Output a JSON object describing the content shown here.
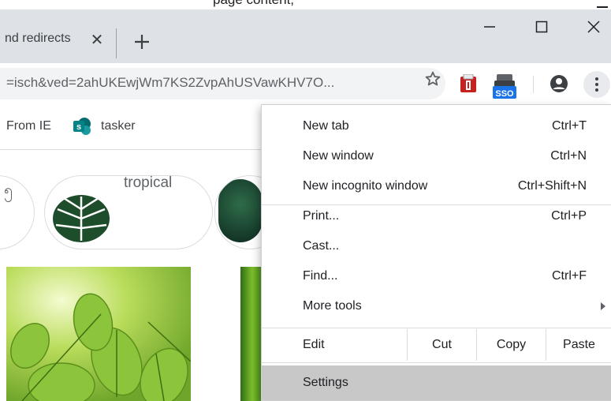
{
  "top_strip": {
    "text": "page content, "
  },
  "tab": {
    "title": "nd redirects",
    "close_glyph": "✕"
  },
  "toolbar": {
    "url": "=isch&ved=2ahUKEwjWm7KS2ZvpAhUSVawKHV7O..."
  },
  "extensions": {
    "sso_label": "SSO"
  },
  "bookmarks": {
    "items": [
      {
        "label": "From IE"
      },
      {
        "label": "tasker",
        "icon_letter": "s"
      }
    ]
  },
  "content": {
    "chips": [
      {
        "label": ""
      },
      {
        "label": "tropical"
      }
    ]
  },
  "menu": {
    "items": [
      {
        "label": "New tab",
        "shortcut": "Ctrl+T"
      },
      {
        "label": "New window",
        "shortcut": "Ctrl+N"
      },
      {
        "label": "New incognito window",
        "shortcut": "Ctrl+Shift+N"
      },
      {
        "label": "Print...",
        "shortcut": "Ctrl+P"
      },
      {
        "label": "Cast...",
        "shortcut": ""
      },
      {
        "label": "Find...",
        "shortcut": "Ctrl+F"
      },
      {
        "label": "More tools",
        "shortcut": ""
      }
    ],
    "edit": {
      "label": "Edit",
      "cut": "Cut",
      "copy": "Copy",
      "paste": "Paste"
    },
    "settings": {
      "label": "Settings"
    }
  },
  "colors": {
    "tabstrip_bg": "#dee1e6",
    "omnibox_bg": "#f1f3f4",
    "menu_hover": "#c8c8c8",
    "sso_blue": "#1a73e8",
    "sharepoint_teal": "#038387"
  }
}
